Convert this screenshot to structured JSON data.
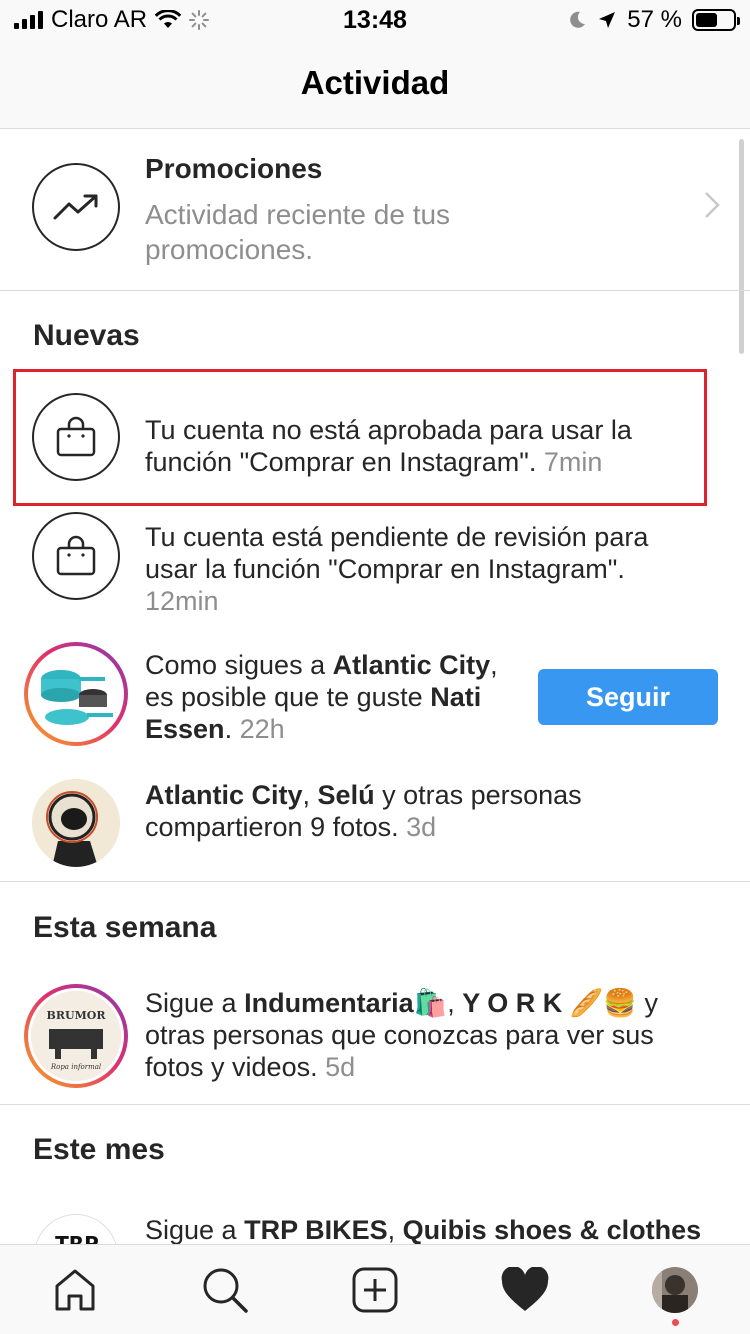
{
  "status_bar": {
    "carrier": "Claro AR",
    "time": "13:48",
    "battery_percent": "57 %",
    "battery_level": 0.57
  },
  "header": {
    "title": "Actividad"
  },
  "promotions": {
    "title": "Promociones",
    "subtitle": "Actividad reciente de tus promociones.",
    "icon": "trending-up-icon"
  },
  "sections": {
    "new": "Nuevas",
    "this_week": "Esta semana",
    "this_month": "Este mes"
  },
  "notifications": {
    "shop_not_approved": {
      "text": "Tu cuenta no está aprobada para usar la función \"Comprar en Instagram\".",
      "time": "7min",
      "icon": "shopping-bag-icon"
    },
    "shop_pending": {
      "text": "Tu cuenta está pendiente de revisión para usar la función \"Comprar en Instagram\".",
      "time": "12min",
      "icon": "shopping-bag-icon"
    },
    "suggestion": {
      "prefix": "Como sigues a ",
      "account1": "Atlantic City",
      "middle": ", es posible que te guste ",
      "account2": "Nati Essen",
      "suffix": ".",
      "time": "22h",
      "button": "Seguir"
    },
    "shared_photos": {
      "account1": "Atlantic City",
      "sep": ", ",
      "account2": "Selú",
      "rest": " y otras personas compartieron 9 fotos.",
      "time": "3d"
    },
    "follow_suggest": {
      "prefix": "Sigue a ",
      "account1": "Indumentaria🛍️",
      "sep": ", ",
      "account2": "Y O R K 🥖🍔",
      "rest": " y otras personas que conozcas para ver sus fotos y videos.",
      "time": "5d",
      "avatar_text": "BRUMOR",
      "avatar_subtext": "Ropa informal"
    },
    "month_suggest": {
      "prefix": "Sigue a ",
      "account1": "TRP BIKES",
      "sep": ", ",
      "account2": "Quibis shoes & clothes",
      "avatar_text": "TRP"
    }
  },
  "tabbar": {
    "items": [
      "home-icon",
      "search-icon",
      "add-post-icon",
      "activity-heart-icon",
      "profile-avatar"
    ]
  },
  "colors": {
    "accent": "#3897f0",
    "highlight": "#e0222f",
    "muted": "#8e8e8e",
    "notification_dot": "#ed4956"
  }
}
